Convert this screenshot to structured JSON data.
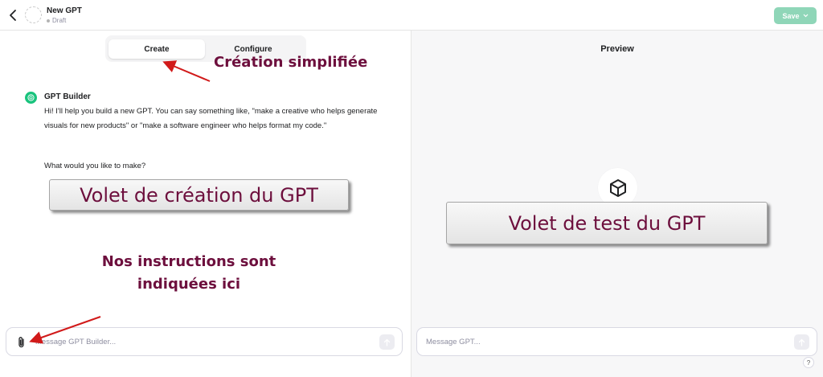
{
  "header": {
    "gpt_name": "New GPT",
    "status": "Draft",
    "save_label": "Save"
  },
  "tabs": [
    {
      "label": "Create",
      "active": true
    },
    {
      "label": "Configure",
      "active": false
    }
  ],
  "builder": {
    "name": "GPT Builder",
    "message": "Hi! I'll help you build a new GPT. You can say something like, \"make a creative who helps generate visuals for new products\" or \"make a software engineer who helps format my code.\"",
    "question": "What would you like to make?"
  },
  "builder_input": {
    "placeholder": "Message GPT Builder..."
  },
  "preview": {
    "title": "Preview",
    "input_placeholder": "Message GPT..."
  },
  "help_label": "?",
  "annotations": {
    "creation": "Création simplifiée",
    "left_panel": "Volet de création du GPT",
    "right_panel": "Volet de test du GPT",
    "instructions_line1": "Nos instructions sont",
    "instructions_line2": "indiquées ici"
  },
  "colors": {
    "save_button": "#8fd6b8",
    "builder_icon": "#19c37d",
    "annotation_text": "#6d0f3d",
    "annotation_arrow": "#d11a1a"
  },
  "icons": {
    "back": "chevron-left-icon",
    "attach": "paperclip-icon",
    "send": "arrow-up-icon",
    "preview_logo": "cube-icon",
    "builder": "openai-logo-icon"
  }
}
